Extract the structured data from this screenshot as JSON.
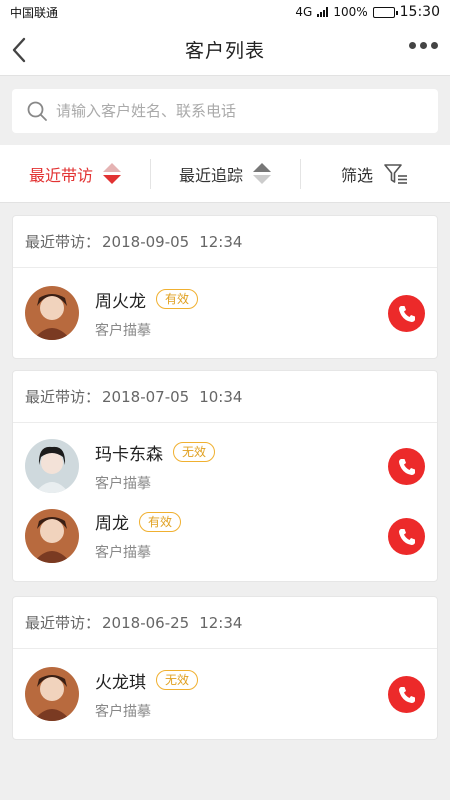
{
  "status_bar": {
    "carrier": "中国联通",
    "network": "4G",
    "battery": "100%",
    "time": "15:30"
  },
  "header": {
    "title": "客户列表",
    "back_icon": "chevron-left-icon",
    "more_icon": "more-dots-icon"
  },
  "search": {
    "placeholder": "请输入客户姓名、联系电话",
    "value": ""
  },
  "filters": [
    {
      "label": "最近带访",
      "active": true
    },
    {
      "label": "最近追踪",
      "active": false
    },
    {
      "label": "筛选",
      "active": false
    }
  ],
  "groups": [
    {
      "label": "最近带访：",
      "date": "2018-09-05",
      "time": "12:34",
      "customers": [
        {
          "name": "周火龙",
          "status": "有效",
          "desc": "客户描摹"
        }
      ]
    },
    {
      "label": "最近带访：",
      "date": "2018-07-05",
      "time": "10:34",
      "customers": [
        {
          "name": "玛卡东森",
          "status": "无效",
          "desc": "客户描摹"
        },
        {
          "name": "周龙",
          "status": "有效",
          "desc": "客户描摹"
        }
      ]
    },
    {
      "label": "最近带访：",
      "date": "2018-06-25",
      "time": "12:34",
      "customers": [
        {
          "name": "火龙琪",
          "status": "无效",
          "desc": "客户描摹"
        }
      ]
    }
  ],
  "colors": {
    "accent_red": "#e23232",
    "call_button": "#ec2a2a",
    "badge_orange": "#f0b030"
  }
}
